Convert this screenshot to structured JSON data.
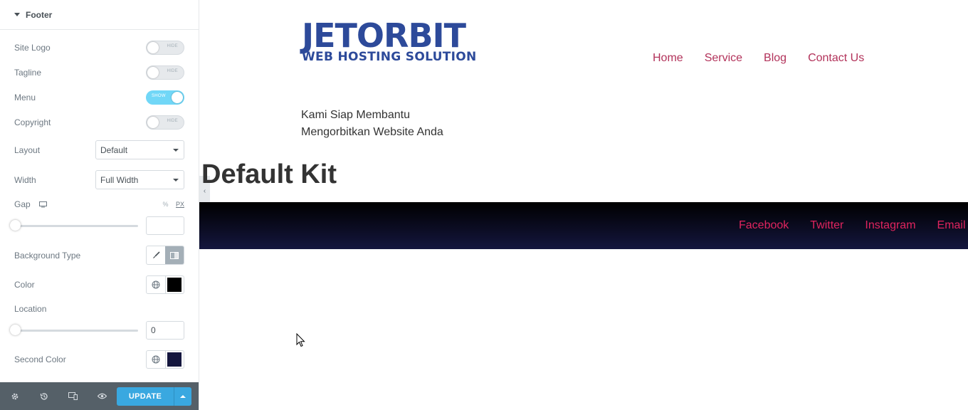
{
  "panel": {
    "section_title": "Footer",
    "controls": {
      "site_logo": {
        "label": "Site Logo",
        "state": "HIDE"
      },
      "tagline": {
        "label": "Tagline",
        "state": "HIDE"
      },
      "menu": {
        "label": "Menu",
        "state": "SHOW"
      },
      "copyright": {
        "label": "Copyright",
        "state": "HIDE"
      },
      "layout": {
        "label": "Layout",
        "value": "Default"
      },
      "width": {
        "label": "Width",
        "value": "Full Width"
      },
      "gap": {
        "label": "Gap",
        "unit_percent": "%",
        "unit_px": "PX",
        "value": ""
      },
      "background_type": {
        "label": "Background Type"
      },
      "color": {
        "label": "Color",
        "swatch": "#000000"
      },
      "location": {
        "label": "Location",
        "value": "0"
      },
      "second_color": {
        "label": "Second Color",
        "swatch": "#14163e"
      }
    },
    "footer": {
      "update_label": "UPDATE"
    }
  },
  "preview": {
    "logo": {
      "brand": "JETORBIT",
      "sub": "WEB HOSTING SOLUTION"
    },
    "nav": [
      "Home",
      "Service",
      "Blog",
      "Contact Us"
    ],
    "tagline_line1": "Kami Siap Membantu",
    "tagline_line2": "Mengorbitkan Website Anda",
    "kit_title": "Default Kit",
    "social": [
      "Facebook",
      "Twitter",
      "Instagram",
      "Email"
    ]
  },
  "colors": {
    "accent": "#b2325a",
    "social": "#e0245e",
    "update": "#39a8e0"
  }
}
